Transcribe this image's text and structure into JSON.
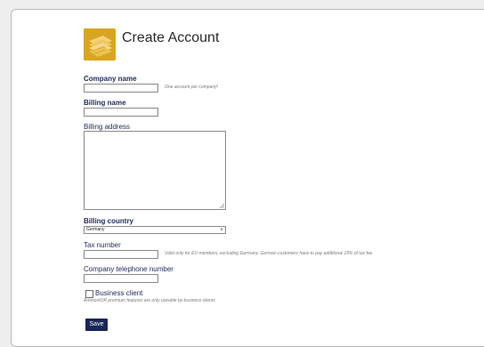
{
  "header": {
    "title": "Create Account",
    "logo_icon": "money-stack-icon"
  },
  "form": {
    "company_name": {
      "label": "Company name",
      "value": "",
      "hint": "One account per company!"
    },
    "billing_name": {
      "label": "Billing name",
      "value": ""
    },
    "billing_address": {
      "label": "Billing address",
      "value": ""
    },
    "billing_country": {
      "label": "Billing country",
      "selected": "Germany"
    },
    "tax_number": {
      "label": "Tax number",
      "value": "",
      "hint": "Valid only for EU members, excluding Germany. German customers have to pay additional 19% of tax fee."
    },
    "company_telephone": {
      "label": "Company telephone number",
      "value": ""
    },
    "business_client": {
      "label": "Business client",
      "checked": false,
      "hint": "AmmontOR premium features are only useable by business clients"
    },
    "save_label": "Save"
  },
  "colors": {
    "accent": "#1a2656",
    "label": "#1e2a5a",
    "logo_bg": "#d9a520"
  }
}
